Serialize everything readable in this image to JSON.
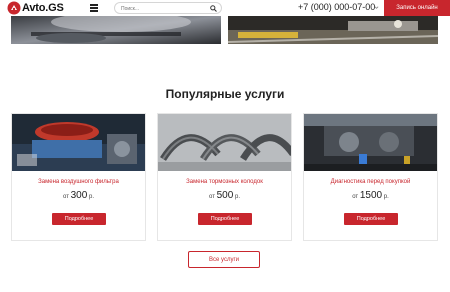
{
  "header": {
    "logo_text": "Avto.GS",
    "search_placeholder": "Поиск...",
    "phone": "+7 (000) 000-07-00",
    "cta_label": "Запись онлайн"
  },
  "main": {
    "section_title": "Популярные услуги",
    "price_prefix": "от",
    "currency": "р.",
    "services": [
      {
        "name": "Замена воздушного фильтра",
        "price": "300",
        "button_label": "Подробнее"
      },
      {
        "name": "Замена тормозных колодок",
        "price": "500",
        "button_label": "Подробнее"
      },
      {
        "name": "Диагностика перед покупкой",
        "price": "1500",
        "button_label": "Подробнее"
      }
    ],
    "all_services_label": "Все услуги"
  },
  "colors": {
    "accent": "#c8262d",
    "text": "#222222",
    "border": "#e6e6e6"
  }
}
